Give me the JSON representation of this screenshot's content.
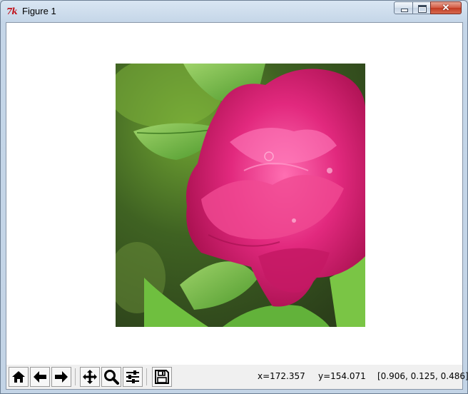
{
  "window": {
    "title": "Figure 1",
    "app_icon_text": "7k",
    "close_glyph": "✕"
  },
  "figure": {
    "image_description_icon": "photo-peony"
  },
  "toolbar": {
    "buttons": [
      {
        "name": "home",
        "icon": "home-icon"
      },
      {
        "name": "back",
        "icon": "arrow-left-icon"
      },
      {
        "name": "forward",
        "icon": "arrow-right-icon"
      },
      {
        "name": "pan",
        "icon": "move-icon"
      },
      {
        "name": "zoom",
        "icon": "magnifier-icon"
      },
      {
        "name": "configure-subplots",
        "icon": "sliders-icon"
      },
      {
        "name": "save",
        "icon": "floppy-disk-icon"
      }
    ],
    "status": {
      "x": "x=172.357",
      "y": "y=154.071",
      "rgb": "[0.906, 0.125, 0.486]"
    }
  },
  "colors": {
    "petal": "#e0277a",
    "petal_dark": "#b5105a",
    "leaf": "#5fae3a",
    "background_green": "#4f7a2a"
  }
}
